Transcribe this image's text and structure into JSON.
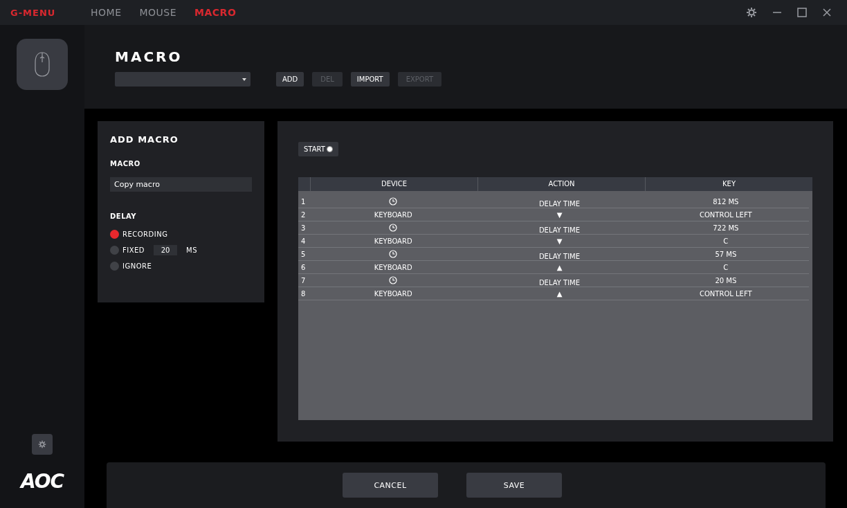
{
  "app_title": "G-MENU",
  "tabs": [
    {
      "label": "HOME",
      "selected": false
    },
    {
      "label": "MOUSE",
      "selected": false
    },
    {
      "label": "MACRO",
      "selected": true
    }
  ],
  "sidebar": {
    "logo": "AOC"
  },
  "header": {
    "title": "MACRO",
    "buttons": [
      {
        "label": "ADD",
        "disabled": false
      },
      {
        "label": "DEL",
        "disabled": true
      },
      {
        "label": "IMPORT",
        "disabled": false
      },
      {
        "label": "EXPORT",
        "disabled": true
      }
    ]
  },
  "add_macro": {
    "title": "ADD MACRO",
    "macro_label": "MACRO",
    "macro_value": "Copy macro",
    "delay_label": "DELAY",
    "delay_options": [
      {
        "label": "RECORDING",
        "selected": true
      },
      {
        "label": "FIXED",
        "selected": false,
        "value": "20",
        "unit": "MS"
      },
      {
        "label": "IGNORE",
        "selected": false
      }
    ]
  },
  "start_button": "START",
  "table": {
    "columns": [
      "DEVICE",
      "ACTION",
      "KEY"
    ],
    "rows": [
      {
        "index": "1",
        "kind": "delay",
        "action": "DELAY TIME",
        "key": "812 MS"
      },
      {
        "index": "2",
        "kind": "key",
        "device": "KEYBOARD",
        "action": "▼",
        "key": "CONTROL LEFT"
      },
      {
        "index": "3",
        "kind": "delay",
        "action": "DELAY TIME",
        "key": "722 MS"
      },
      {
        "index": "4",
        "kind": "key",
        "device": "KEYBOARD",
        "action": "▼",
        "key": "C"
      },
      {
        "index": "5",
        "kind": "delay",
        "action": "DELAY TIME",
        "key": "57 MS"
      },
      {
        "index": "6",
        "kind": "key",
        "device": "KEYBOARD",
        "action": "▲",
        "key": "C"
      },
      {
        "index": "7",
        "kind": "delay",
        "action": "DELAY TIME",
        "key": "20 MS"
      },
      {
        "index": "8",
        "kind": "key",
        "device": "KEYBOARD",
        "action": "▲",
        "key": "CONTROL LEFT"
      }
    ]
  },
  "footer": {
    "buttons": [
      "CANCEL",
      "SAVE"
    ]
  }
}
